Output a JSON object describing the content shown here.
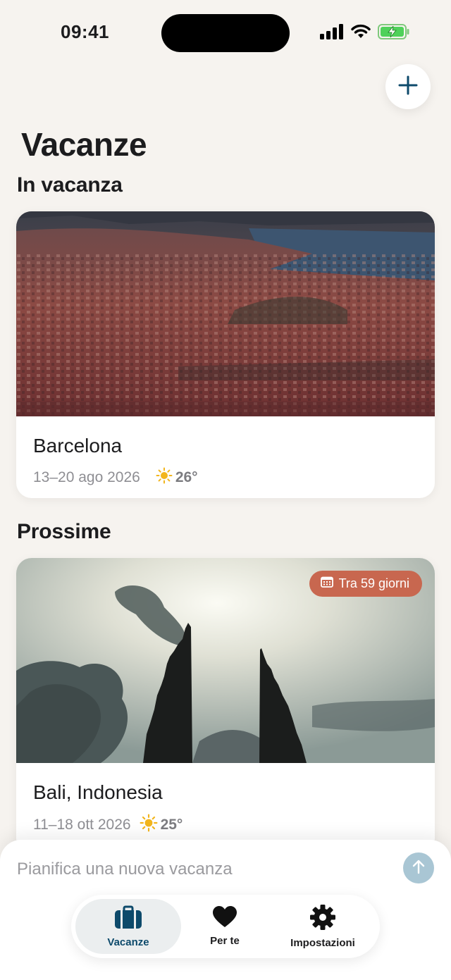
{
  "status_bar": {
    "time": "09:41"
  },
  "header": {
    "title": "Vacanze",
    "add_icon": "plus-icon"
  },
  "sections": {
    "current": "In vacanza",
    "upcoming": "Prossime"
  },
  "trips": {
    "current": {
      "title": "Barcelona",
      "dates": "13–20 ago 2026",
      "weather_icon": "sun-icon",
      "temperature": "26°"
    },
    "upcoming": {
      "title": "Bali, Indonesia",
      "dates": "11–18 ott 2026",
      "weather_icon": "sun-icon",
      "temperature": "25°",
      "badge": "Tra 59 giorni",
      "badge_icon": "calendar-icon"
    }
  },
  "composer": {
    "placeholder": "Pianifica una nuova vacanza",
    "send_icon": "arrow-up-icon"
  },
  "tabs": [
    {
      "label": "Vacanze",
      "icon": "suitcase-icon",
      "active": true
    },
    {
      "label": "Per te",
      "icon": "heart-icon",
      "active": false
    },
    {
      "label": "Impostazioni",
      "icon": "gear-icon",
      "active": false
    }
  ],
  "colors": {
    "background": "#f6f3ef",
    "accent": "#0d4a6b",
    "badge": "#c8674f",
    "sun": "#f2b51c",
    "send_button": "#a9c6d4"
  }
}
